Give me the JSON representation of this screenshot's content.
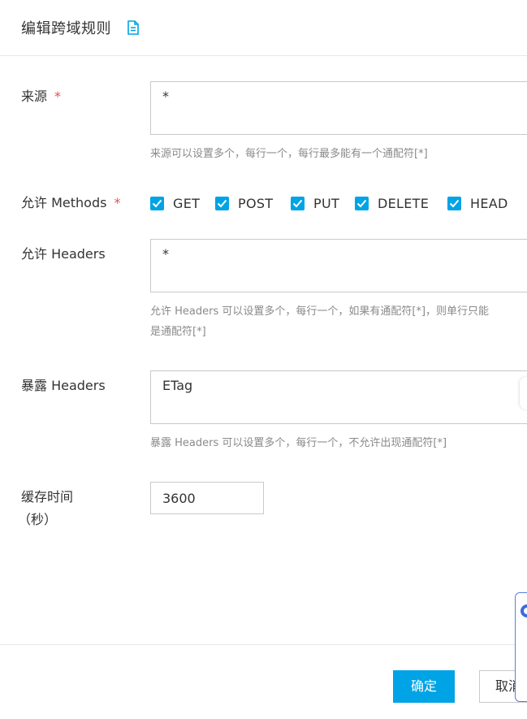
{
  "dialog": {
    "title": "编辑跨域规则",
    "doc_icon": "document-icon"
  },
  "form": {
    "origin": {
      "label": "来源",
      "required_mark": "*",
      "value": "*",
      "hint": "来源可以设置多个，每行一个，每行最多能有一个通配符[*]"
    },
    "methods": {
      "label": "允许 Methods",
      "required_mark": "*",
      "options": [
        {
          "label": "GET",
          "checked": true
        },
        {
          "label": "POST",
          "checked": true
        },
        {
          "label": "PUT",
          "checked": true
        },
        {
          "label": "DELETE",
          "checked": true
        },
        {
          "label": "HEAD",
          "checked": true
        }
      ]
    },
    "allow_headers": {
      "label": "允许 Headers",
      "value": "*",
      "hint_line1": "允许 Headers 可以设置多个，每行一个，如果有通配符[*]，则单行只能",
      "hint_line2": "是通配符[*]"
    },
    "expose_headers": {
      "label": "暴露 Headers",
      "value": "ETag",
      "hint": "暴露 Headers 可以设置多个，每行一个，不允许出现通配符[*]"
    },
    "cache_time": {
      "label_line1": "缓存时间",
      "label_line2": "（秒）",
      "value": "3600"
    }
  },
  "footer": {
    "confirm_label": "确定",
    "cancel_label": "取消"
  },
  "colors": {
    "accent": "#00a3e5",
    "required": "#e84f4f",
    "hint": "#8a8a8a"
  }
}
